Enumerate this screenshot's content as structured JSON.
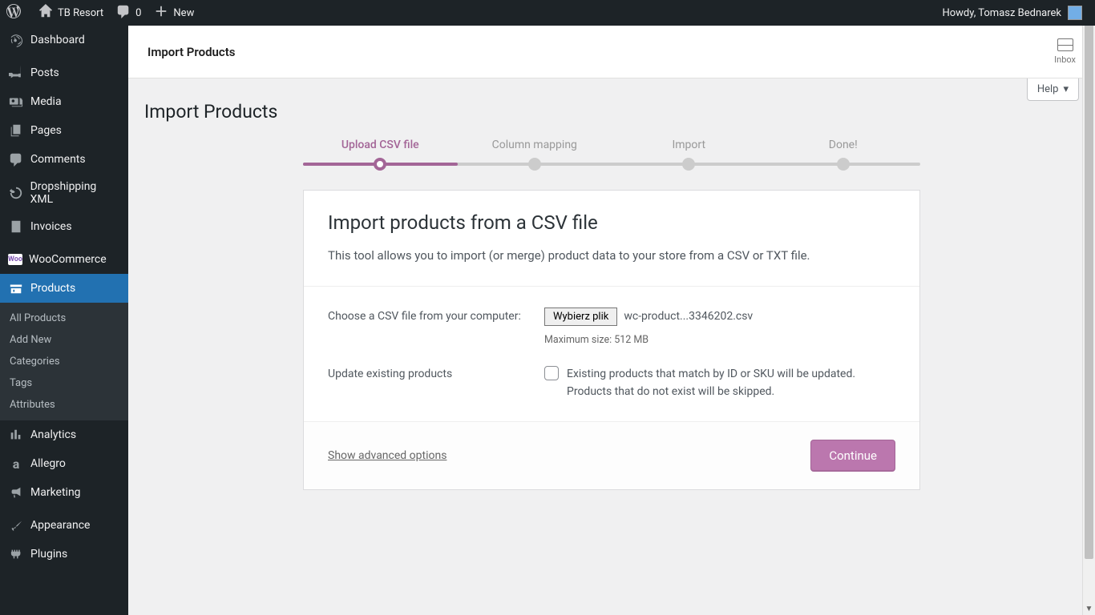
{
  "adminbar": {
    "site_name": "TB Resort",
    "comments_count": "0",
    "new_label": "New",
    "howdy": "Howdy, Tomasz Bednarek"
  },
  "sidebar": {
    "dashboard": "Dashboard",
    "posts": "Posts",
    "media": "Media",
    "pages": "Pages",
    "comments": "Comments",
    "dropshipping": "Dropshipping XML",
    "invoices": "Invoices",
    "woocommerce": "WooCommerce",
    "products": "Products",
    "products_sub": {
      "all": "All Products",
      "add": "Add New",
      "categories": "Categories",
      "tags": "Tags",
      "attributes": "Attributes"
    },
    "analytics": "Analytics",
    "allegro": "Allegro",
    "marketing": "Marketing",
    "appearance": "Appearance",
    "plugins": "Plugins"
  },
  "wc_header": {
    "title": "Import Products",
    "inbox": "Inbox"
  },
  "help_label": "Help",
  "page": {
    "title": "Import Products"
  },
  "steps": {
    "upload": "Upload CSV file",
    "mapping": "Column mapping",
    "import": "Import",
    "done": "Done!"
  },
  "card": {
    "title": "Import products from a CSV file",
    "desc": "This tool allows you to import (or merge) product data to your store from a CSV or TXT file.",
    "choose_label": "Choose a CSV file from your computer:",
    "file_button": "Wybierz plik",
    "file_name": "wc-product...3346202.csv",
    "max_size": "Maximum size: 512 MB",
    "update_label": "Update existing products",
    "update_desc": "Existing products that match by ID or SKU will be updated. Products that do not exist will be skipped.",
    "advanced": "Show advanced options",
    "continue": "Continue"
  }
}
